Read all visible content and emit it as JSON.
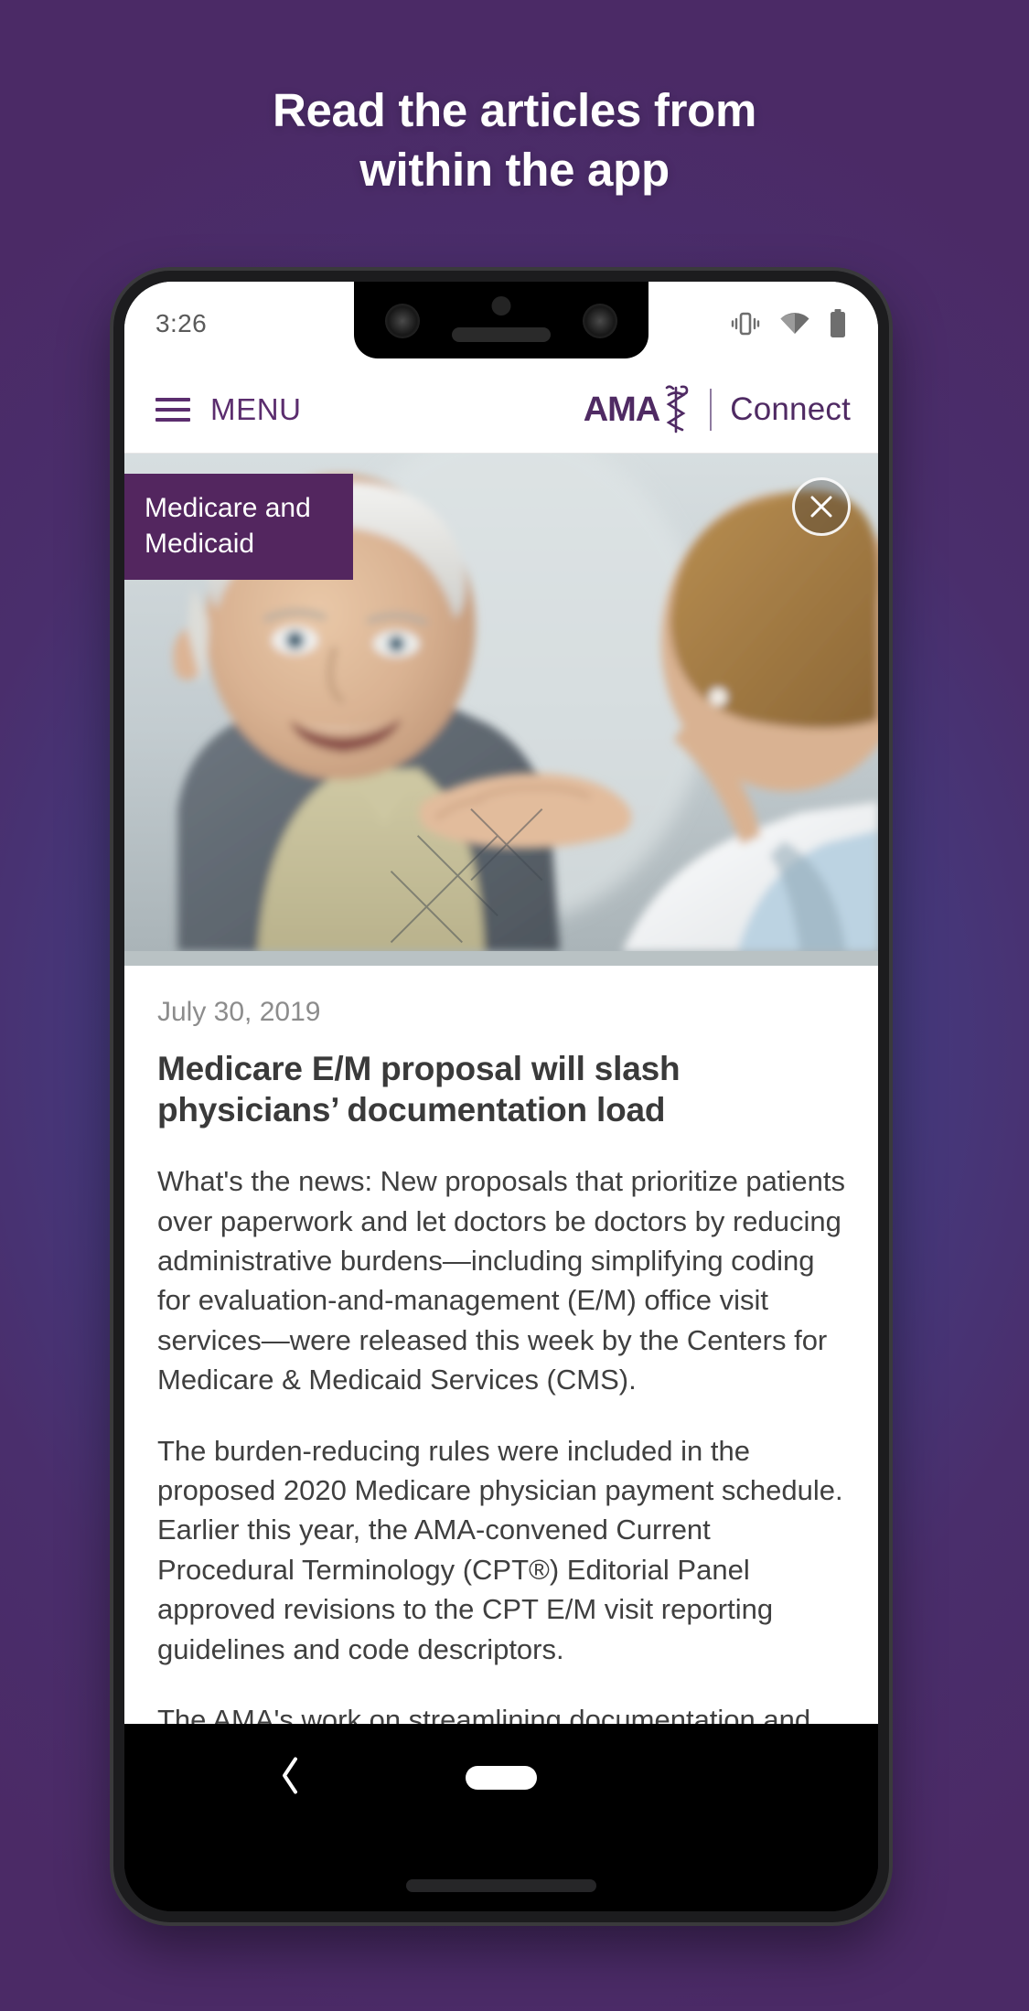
{
  "promo": {
    "line1": "Read the articles from",
    "line2": "within the app"
  },
  "colors": {
    "ama_purple": "#4f2a63",
    "badge_purple": "#53265f",
    "bg_purple": "#4b2a66",
    "bg_blue": "#3a5296",
    "text_body": "#3f3f3f",
    "text_muted": "#8c8c8c"
  },
  "status_bar": {
    "time": "3:26",
    "icons": [
      "vibrate-icon",
      "wifi-icon",
      "battery-icon"
    ]
  },
  "app_header": {
    "menu_label": "MENU",
    "hamburger_icon": "hamburger-icon",
    "brand_wordmark": "AMA",
    "brand_logo_icon": "caduceus-icon",
    "brand_product": "Connect"
  },
  "hero": {
    "category_badge": "Medicare and Medicaid",
    "close_icon": "close-icon",
    "image_alt": "smiling elderly man with physician hand on his shoulder"
  },
  "article": {
    "date": "July 30, 2019",
    "title": "Medicare E/M proposal will slash physicians’ documentation load",
    "paragraphs": [
      "What's the news: New proposals that prioritize patients over paperwork and let doctors be doctors by reducing administrative burdens—including simplifying coding for evaluation-and-management (E/M) office visit services—were released this week by the Centers for Medicare & Medicaid Services (CMS).",
      "The burden-reducing rules were included in the proposed 2020 Medicare physician payment schedule. Earlier this year, the AMA-convened Current Procedural Terminology (CPT®) Editorial Panel approved revisions to the CPT E/M visit reporting guidelines and code descriptors.",
      "The AMA's work on streamlining documentation and reducing note bloat is far from over. Subscribe now to stay in the loop on continued CPT reform."
    ]
  },
  "nav_bar": {
    "back_icon": "back-chevron-icon",
    "home_icon": "home-pill-icon"
  }
}
